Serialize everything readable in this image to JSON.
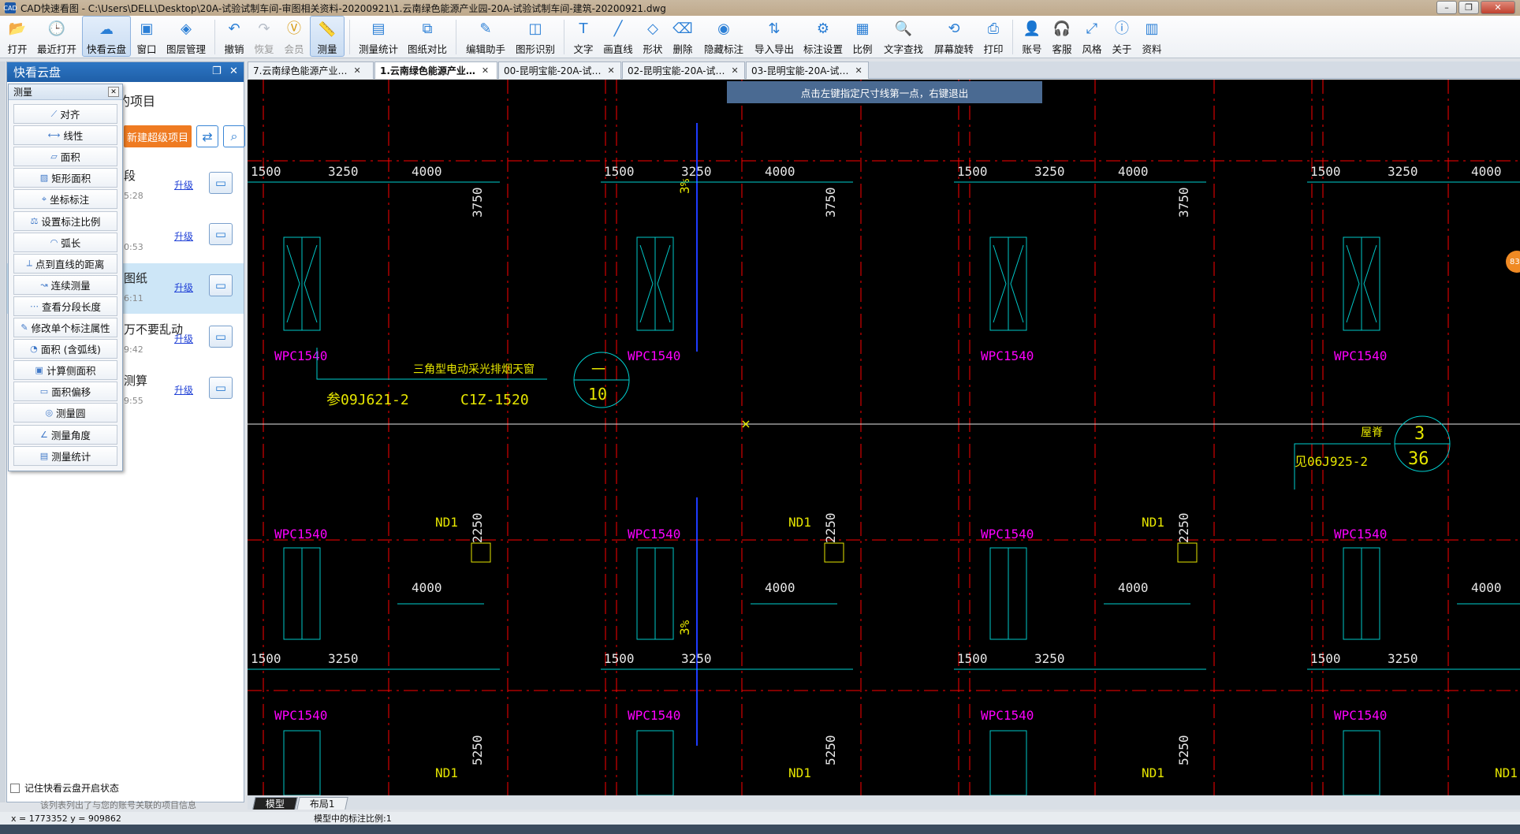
{
  "window": {
    "title": "CAD快速看图 - C:\\Users\\DELL\\Desktop\\20A-试验试制车间-审图相关资料-20200921\\1.云南绿色能源产业园-20A-试验试制车间-建筑-20200921.dwg",
    "app_icon": "CAD"
  },
  "toolbar": [
    {
      "label": "打开",
      "icon": "open-folder-icon",
      "glyph": "📂"
    },
    {
      "label": "最近打开",
      "icon": "recent-clock-icon",
      "glyph": "🕒"
    },
    {
      "label": "快看云盘",
      "icon": "cloud-icon",
      "glyph": "☁",
      "active": true
    },
    {
      "label": "窗口",
      "icon": "window-icon",
      "glyph": "▣"
    },
    {
      "label": "图层管理",
      "icon": "layers-icon",
      "glyph": "◈"
    },
    {
      "label": "撤销",
      "icon": "undo-icon",
      "glyph": "↶"
    },
    {
      "label": "恢复",
      "icon": "redo-icon",
      "glyph": "↷",
      "disabled": true
    },
    {
      "label": "会员",
      "icon": "vip-icon",
      "glyph": "Ⓥ",
      "disabled": true,
      "vip": true
    },
    {
      "label": "测量",
      "icon": "ruler-icon",
      "glyph": "📏",
      "active": true
    },
    {
      "label": "测量统计",
      "icon": "measure-stats-icon",
      "glyph": "▤"
    },
    {
      "label": "图纸对比",
      "icon": "compare-icon",
      "glyph": "⧉"
    },
    {
      "label": "编辑助手",
      "icon": "edit-assistant-icon",
      "glyph": "✎"
    },
    {
      "label": "图形识别",
      "icon": "shape-recognize-icon",
      "glyph": "◫"
    },
    {
      "label": "文字",
      "icon": "text-icon",
      "glyph": "T"
    },
    {
      "label": "画直线",
      "icon": "line-icon",
      "glyph": "╱"
    },
    {
      "label": "形状",
      "icon": "shape-icon",
      "glyph": "◇"
    },
    {
      "label": "删除",
      "icon": "eraser-icon",
      "glyph": "⌫"
    },
    {
      "label": "隐藏标注",
      "icon": "hide-annotation-icon",
      "glyph": "◉"
    },
    {
      "label": "导入导出",
      "icon": "import-export-icon",
      "glyph": "⇅"
    },
    {
      "label": "标注设置",
      "icon": "annotation-settings-icon",
      "glyph": "⚙"
    },
    {
      "label": "比例",
      "icon": "scale-icon",
      "glyph": "▦"
    },
    {
      "label": "文字查找",
      "icon": "text-search-icon",
      "glyph": "🔍"
    },
    {
      "label": "屏幕旋转",
      "icon": "rotate-screen-icon",
      "glyph": "⟲"
    },
    {
      "label": "打印",
      "icon": "print-icon",
      "glyph": "⎙"
    },
    {
      "label": "账号",
      "icon": "account-icon",
      "glyph": "👤"
    },
    {
      "label": "客服",
      "icon": "headset-icon",
      "glyph": "🎧"
    },
    {
      "label": "风格",
      "icon": "style-icon",
      "glyph": "⤢"
    },
    {
      "label": "关于",
      "icon": "info-icon",
      "glyph": "ⓘ"
    },
    {
      "label": "资料",
      "icon": "materials-icon",
      "glyph": "▥"
    }
  ],
  "left_panel": {
    "title": "快看云盘",
    "projects_title": "的项目",
    "new_project": "新建超级项目",
    "refresh_icon": "sync-icon",
    "search_icon": "search-icon",
    "upgrade": "升级",
    "rows": [
      {
        "name": "段",
        "time": "5:28",
        "selected": false
      },
      {
        "name": "",
        "time": "0:53",
        "selected": false
      },
      {
        "name": "图纸",
        "time": "6:11",
        "selected": true
      },
      {
        "name": "万不要乱动",
        "time": "9:42",
        "selected": false
      },
      {
        "name": "测算",
        "time": "9:55",
        "selected": false
      }
    ],
    "remember": "记住快看云盘开启状态",
    "hint": "该列表列出了与您的账号关联的项目信息"
  },
  "measure_menu": {
    "title": "测量",
    "items": [
      "对齐",
      "线性",
      "面积",
      "矩形面积",
      "坐标标注",
      "设置标注比例",
      "弧长",
      "点到直线的距离",
      "连续测量",
      "查看分段长度",
      "修改单个标注属性",
      "面积 (含弧线)",
      "计算侧面积",
      "面积偏移",
      "测量圆",
      "测量角度",
      "测量统计"
    ]
  },
  "doc_tabs": [
    {
      "label": "7.云南绿色能源产业…",
      "active": false
    },
    {
      "label": "1.云南绿色能源产业…",
      "active": true
    },
    {
      "label": "00-昆明宝能-20A-试…",
      "active": false
    },
    {
      "label": "02-昆明宝能-20A-试…",
      "active": false
    },
    {
      "label": "03-昆明宝能-20A-试…",
      "active": false
    }
  ],
  "tooltip": "点击左键指定尺寸线第一点，右键退出",
  "drawing": {
    "dims": [
      "1500",
      "3250",
      "4000",
      "3750",
      "2250",
      "5250"
    ],
    "window_tag": "WPC1540",
    "door_tag": "ND1",
    "slope": "3%",
    "callout1": {
      "text": "三角型电动采光排烟天窗",
      "ref": "参09J621-2",
      "code": "C1Z-1520",
      "num_top": "一",
      "num_bot": "10"
    },
    "callout2": {
      "text": "屋脊",
      "ref": "见06J925-2",
      "num_top": "3",
      "num_bot": "36"
    },
    "colors": {
      "bg": "#000000",
      "dim": "#00d0d0",
      "text": "#e6e600",
      "magenta": "#ff00ff",
      "axis": "#ff0000",
      "blue": "#1e3cff",
      "cyan": "#00c8c8",
      "white": "#e8e8e8"
    }
  },
  "layout_tabs": [
    "模型",
    "布局1"
  ],
  "status": {
    "coords": "x = 1773352  y = 909862",
    "scale": "模型中的标注比例:1"
  },
  "badge": "83"
}
